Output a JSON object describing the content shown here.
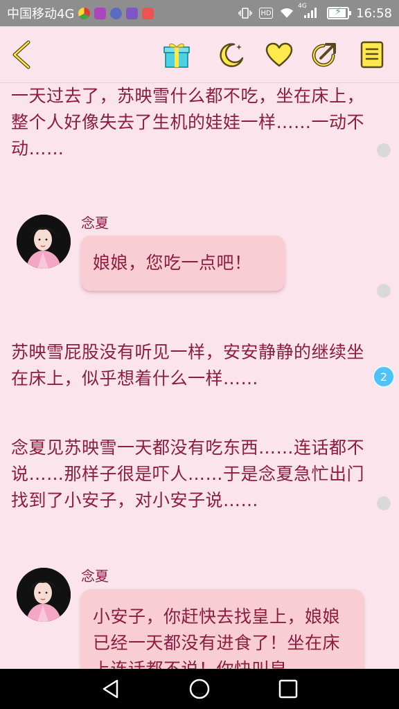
{
  "status_bar": {
    "carrier": "中国移动4G",
    "network": "4G",
    "hd": "HD",
    "time": "16:58",
    "notification_icons": [
      "chrome-icon",
      "gallery-icon",
      "app-icon",
      "keyboard-icon",
      "weibo-icon"
    ],
    "battery_level": 0.9
  },
  "toolbar": {
    "icons": [
      "back-arrow-icon",
      "gift-icon",
      "moon-icon",
      "heart-icon",
      "share-icon",
      "book-icon"
    ]
  },
  "story": {
    "narration_1": "一天过去了，苏映雪什么都不吃，坐在床上，整个人好像失去了生机的娃娃一样……一动不动……",
    "message_1": {
      "speaker": "念夏",
      "text": "娘娘，您吃一点吧！"
    },
    "narration_2": "苏映雪屁股没有听见一样，安安静静的继续坐在床上，似乎想着什么一样……",
    "badge_count": "2",
    "narration_3": "念夏见苏映雪一天都没有吃东西……连话都不说……那样子很是吓人……于是念夏急忙出门找到了小安子，对小安子说……",
    "message_2": {
      "speaker": "念夏",
      "text": "小安子，你赶快去找皇上，娘娘已经一天都没有进食了！坐在床上连话都不说！你快叫皇"
    }
  },
  "colors": {
    "background": "#fce4ec",
    "text": "#8b1d3e",
    "bubble": "#f9cdd4",
    "accent_yellow": "#ffe94d",
    "badge": "#4fc3f7"
  },
  "nav_bar": {
    "icons": [
      "back-triangle-icon",
      "home-circle-icon",
      "recents-square-icon"
    ]
  }
}
